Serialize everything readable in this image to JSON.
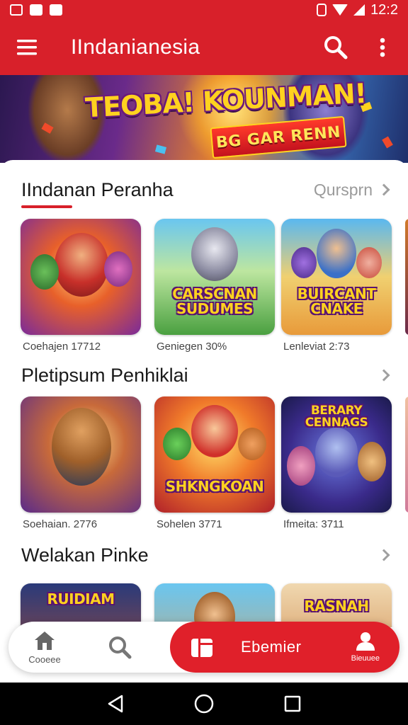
{
  "status_bar": {
    "time": "12:2"
  },
  "app_bar": {
    "title": "IIndanianesia"
  },
  "banner": {
    "title": "TEOBA! KOUNMAN!",
    "subtitle": "BG GAR RENN"
  },
  "sections": [
    {
      "title": "IIndanan Peranha",
      "link": "Qursprn",
      "cards": [
        {
          "caption": "Coehajen 17712",
          "logo": ""
        },
        {
          "caption": "Geniegen 30%",
          "logo": "CARSCNAN SUDUMES"
        },
        {
          "caption": "Lenleviat 2:73",
          "logo": "BUIRCANT CNAKE"
        }
      ]
    },
    {
      "title": "Pletipsum Penhiklai",
      "link": "",
      "cards": [
        {
          "caption": "Soehaian. 2776",
          "logo": ""
        },
        {
          "caption": "Sohelen 3771",
          "logo": "SHKNGKOAN"
        },
        {
          "caption": "Ifmeita: 3711",
          "logo": "BERARY CENNAGS"
        }
      ]
    },
    {
      "title": "Welakan Pinke",
      "link": "",
      "cards": [
        {
          "caption": "",
          "logo": "RUIDIAM"
        },
        {
          "caption": "",
          "logo": ""
        },
        {
          "caption": "",
          "logo": "RASNAH"
        }
      ]
    }
  ],
  "bottom_nav": {
    "home_label": "Cooeee",
    "active_label": "Ebemier",
    "profile_label": "Bieuuee"
  },
  "colors": {
    "brand_red": "#d8202a",
    "title_yellow": "#ffd21f"
  },
  "icons": [
    "menu-icon",
    "search-icon",
    "more-vertical-icon",
    "home-icon",
    "library-icon",
    "profile-icon",
    "back-icon",
    "home-circle-icon",
    "recents-icon"
  ]
}
